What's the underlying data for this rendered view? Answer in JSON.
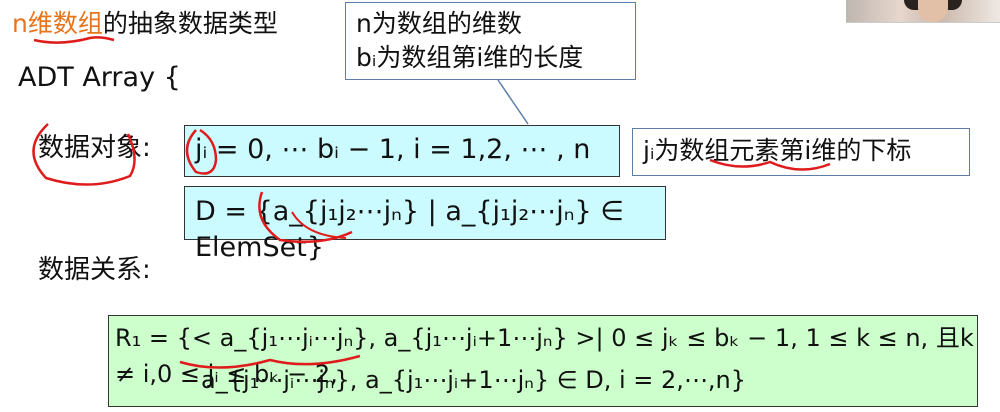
{
  "title": {
    "highlight": "n维数组",
    "rest": "的抽象数据类型"
  },
  "adt_header": "ADT Array {",
  "callout_top": {
    "line1": "n为数组的维数",
    "line2": "bᵢ为数组第i维的长度"
  },
  "data_object": {
    "label": "数据对象:",
    "j_definition": "jᵢ = 0, ⋯ bᵢ − 1,   i = 1,2, ⋯ , n",
    "d_definition": "D = {a_{j₁j₂⋯jₙ}  |  a_{j₁j₂⋯jₙ} ∈ ElemSet}"
  },
  "callout_right": "jᵢ为数组元素第i维的下标",
  "data_relation": {
    "label": "数据关系:",
    "line1": "R₁ = {< a_{j₁⋯jᵢ⋯jₙ}, a_{j₁⋯jᵢ+1⋯jₙ} >| 0 ≤ jₖ ≤ bₖ − 1, 1 ≤ k ≤ n, 且k ≠ i,0 ≤ jᵢ ≤ bₖ − 2,",
    "line2": "a_{j₁⋯jᵢ⋯jₙ}, a_{j₁⋯jᵢ+1⋯jₙ} ∈ D,  i = 2,⋯,n}"
  },
  "colors": {
    "title_highlight": "#e8741c",
    "cyan_box": "#ccfbff",
    "green_box": "#ccffcc",
    "callout_border": "#5b7fa8",
    "ink": "#e01b1b"
  }
}
